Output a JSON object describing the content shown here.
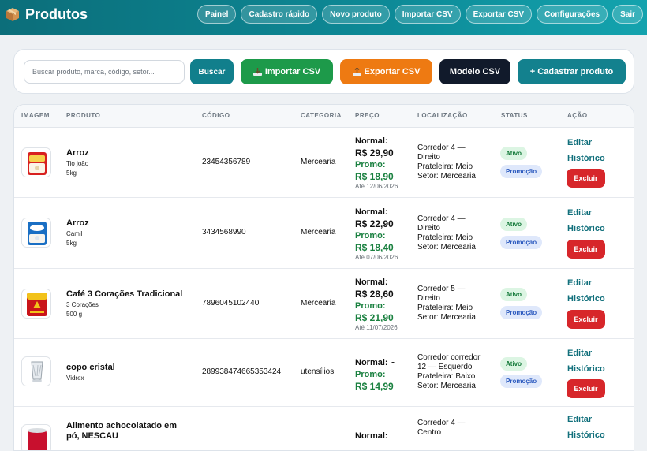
{
  "header": {
    "title": "Produtos",
    "nav": [
      "Painel",
      "Cadastro rápido",
      "Novo produto",
      "Importar CSV",
      "Exportar CSV",
      "Configurações",
      "Sair"
    ]
  },
  "toolbar": {
    "search_placeholder": "Buscar produto, marca, código, setor...",
    "search_button": "Buscar",
    "import_button": "Importar CSV",
    "export_button": "Exportar CSV",
    "model_button": "Modelo CSV",
    "add_button": "+ Cadastrar produto"
  },
  "table": {
    "columns": [
      "IMAGEM",
      "PRODUTO",
      "CÓDIGO",
      "CATEGORIA",
      "PREÇO",
      "LOCALIZAÇÃO",
      "STATUS",
      "AÇÃO"
    ],
    "labels": {
      "normal": "Normal:",
      "promo": "Promo:",
      "active": "Ativo",
      "promotion": "Promoção",
      "edit": "Editar",
      "history": "Histórico",
      "delete": "Excluir"
    },
    "rows": [
      {
        "image_icon": "rice-package-icon",
        "name": "Arroz",
        "brand": "Tio joão",
        "size": "5kg",
        "code": "23454356789",
        "category": "Mercearia",
        "normal_price": "R$ 29,90",
        "promo_price": "R$ 18,90",
        "promo_until": "Até 12/06/2026",
        "location": [
          "Corredor 4 —",
          "Direito",
          "Prateleira: Meio",
          "Setor: Mercearia"
        ]
      },
      {
        "image_icon": "rice-package-icon",
        "name": "Arroz",
        "brand": "Camil",
        "size": "5kg",
        "code": "3434568990",
        "category": "Mercearia",
        "normal_price": "R$ 22,90",
        "promo_price": "R$ 18,40",
        "promo_until": "Até 07/06/2026",
        "location": [
          "Corredor 4 —",
          "Direito",
          "Prateleira: Meio",
          "Setor: Mercearia"
        ]
      },
      {
        "image_icon": "coffee-package-icon",
        "name": "Café 3 Corações Tradicional",
        "brand": "3 Corações",
        "size": "500 g",
        "code": "7896045102440",
        "category": "Mercearia",
        "normal_price": "R$ 28,60",
        "promo_price": "R$ 21,90",
        "promo_until": "Até 11/07/2026",
        "location": [
          "Corredor 5 —",
          "Direito",
          "Prateleira: Meio",
          "Setor: Mercearia"
        ]
      },
      {
        "image_icon": "glass-cup-icon",
        "name": "copo cristal",
        "brand": "Vidrex",
        "size": "",
        "code": "289938474665353424",
        "category": "utensílios",
        "normal_price": "-",
        "promo_price": "R$ 14,99",
        "promo_until": "",
        "location": [
          "Corredor corredor",
          "12 — Esquerdo",
          "Prateleira: Baixo",
          "Setor: Mercearia"
        ]
      },
      {
        "image_icon": "chocolate-drink-can-icon",
        "name": "Alimento achocolatado em pó, NESCAU",
        "brand": "",
        "size": "",
        "code": "",
        "category": "",
        "normal_price": "",
        "promo_price": "",
        "promo_until": "",
        "location": [
          "Corredor 4 —",
          "Centro",
          "",
          ""
        ]
      }
    ]
  }
}
